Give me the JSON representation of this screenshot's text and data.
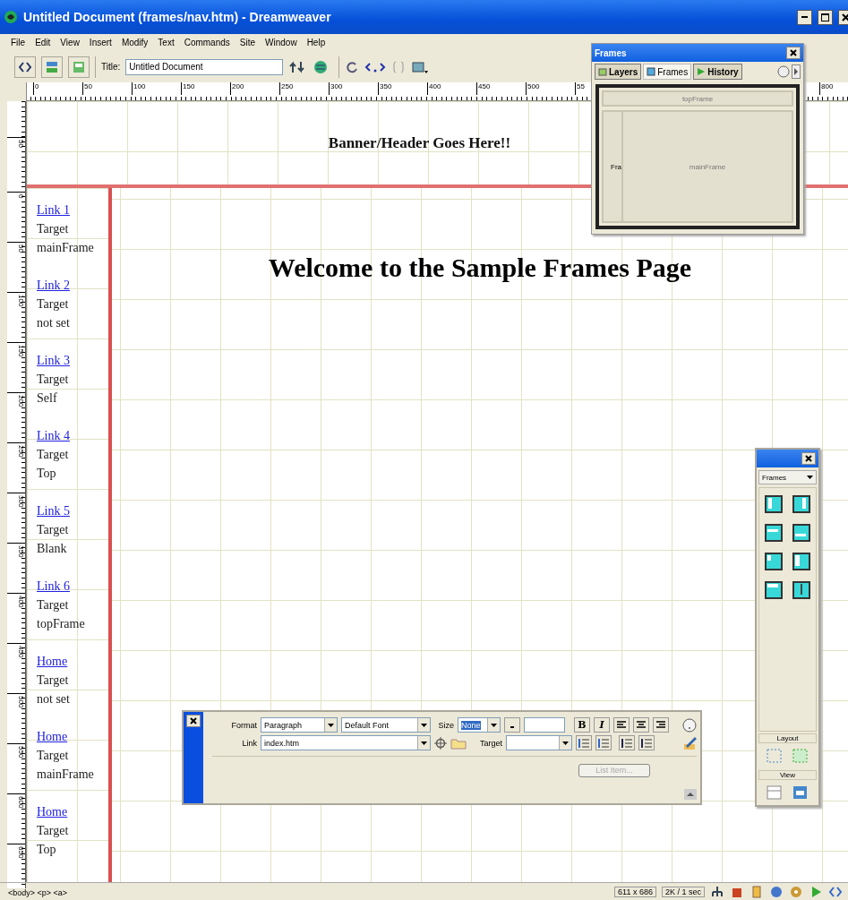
{
  "window": {
    "title": "Untitled Document (frames/nav.htm) - Dreamweaver"
  },
  "menu": [
    "File",
    "Edit",
    "View",
    "Insert",
    "Modify",
    "Text",
    "Commands",
    "Site",
    "Window",
    "Help"
  ],
  "toolbar": {
    "title_label": "Title:",
    "title_value": "Untitled Document"
  },
  "ruler": {
    "labels": [
      "0",
      "50",
      "100",
      "150",
      "200",
      "250",
      "300",
      "350",
      "400",
      "450",
      "500",
      "55"
    ],
    "right_label": "800"
  },
  "vertical_ruler": {
    "banner_label": "50",
    "labels": [
      "0",
      "50",
      "100",
      "150",
      "200",
      "250",
      "300",
      "350",
      "400",
      "450",
      "500",
      "550",
      "600",
      "650"
    ]
  },
  "banner": {
    "text": "Banner/Header Goes Here!!"
  },
  "nav": [
    {
      "link": "Link 1",
      "target_label": "Target",
      "target": "mainFrame"
    },
    {
      "link": "Link 2",
      "target_label": "Target",
      "target": "not set"
    },
    {
      "link": "Link 3",
      "target_label": "Target",
      "target": "Self"
    },
    {
      "link": "Link 4",
      "target_label": "Target",
      "target": "Top"
    },
    {
      "link": "Link 5",
      "target_label": "Target",
      "target": "Blank"
    },
    {
      "link": "Link 6",
      "target_label": "Target",
      "target": "topFrame"
    },
    {
      "link": "Home",
      "target_label": "Target",
      "target": "not set"
    },
    {
      "link": "Home",
      "target_label": "Target",
      "target": "mainFrame"
    },
    {
      "link": "Home",
      "target_label": "Target",
      "target": "Top"
    }
  ],
  "main": {
    "heading": "Welcome to the Sample Frames Page"
  },
  "frames_panel": {
    "title": "Frames",
    "tabs": [
      {
        "label": "Layers",
        "selected": false
      },
      {
        "label": "Frames",
        "selected": true
      },
      {
        "label": "History",
        "selected": false
      }
    ],
    "diagram": {
      "top": "topFrame",
      "left": "Fra",
      "main": "mainFrame"
    }
  },
  "insert_panel": {
    "category": "Frames",
    "sections": [
      "Layout",
      "View"
    ]
  },
  "property_inspector": {
    "format_label": "Format",
    "format": "Paragraph",
    "font": "Default Font",
    "size_label": "Size",
    "size": "None",
    "bold": "B",
    "italic": "I",
    "link_label": "Link",
    "link": "index.htm",
    "target_label": "Target",
    "list_button": {
      "label": "List Item...",
      "disabled": true
    }
  },
  "status_bar": {
    "tags": "<body> <p> <a>",
    "size": "611 x 686",
    "download": "2K / 1 sec"
  }
}
